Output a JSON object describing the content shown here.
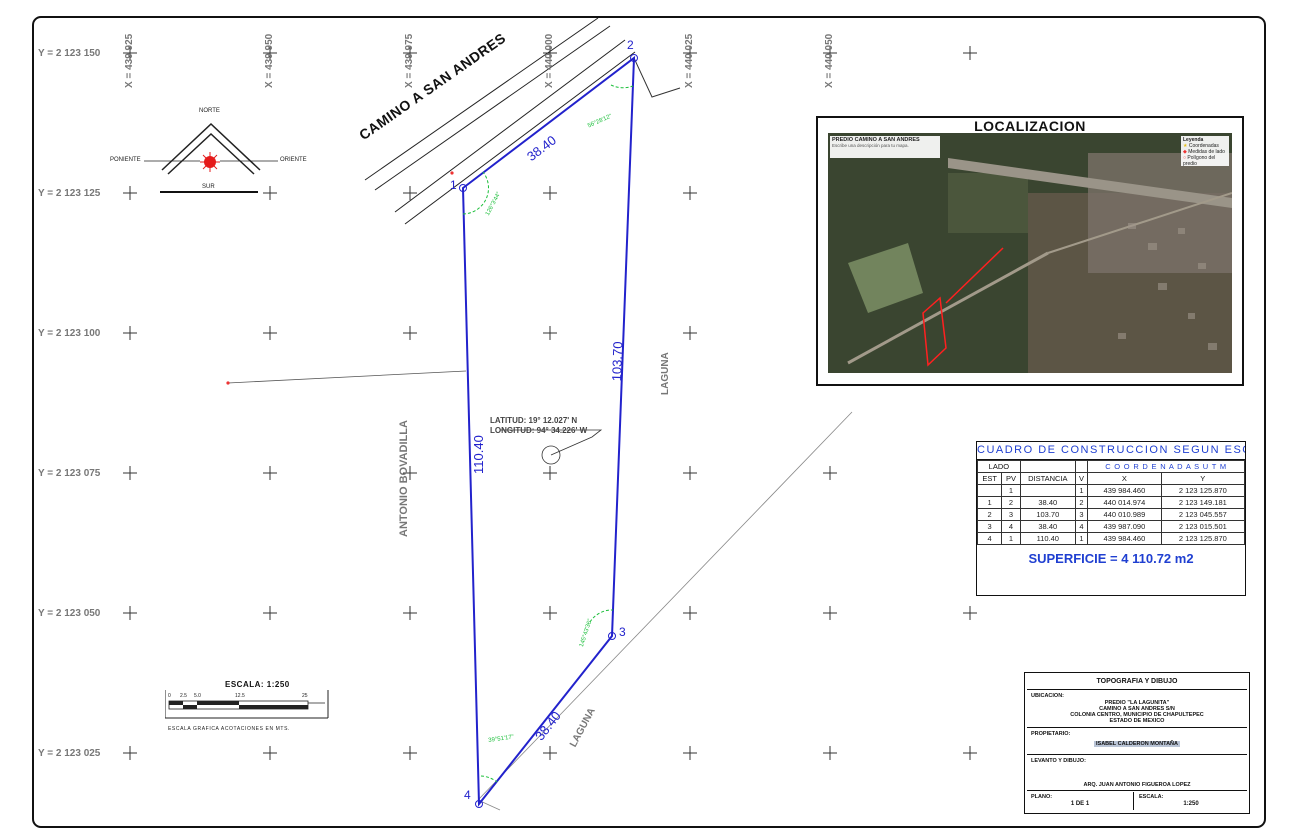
{
  "grid": {
    "y_labels": [
      "Y = 2 123 150",
      "Y = 2 123 125",
      "Y = 2 123 100",
      "Y = 2 123 075",
      "Y = 2 123 050",
      "Y = 2 123 025"
    ],
    "x_labels": [
      "X = 439 925",
      "X = 439 950",
      "X = 439 975",
      "X = 440 000",
      "X = 440 025",
      "X = 440 050"
    ]
  },
  "compass": {
    "north": "NORTE",
    "south": "SUR",
    "east": "ORIENTE",
    "west": "PONIENTE"
  },
  "streets": {
    "top_road": "CAMINO A SAN ANDRES",
    "west": "ANTONIO BOVADILLA",
    "east": "LAGUNA",
    "southeast": "LAGUNA"
  },
  "polygon": {
    "vertex_labels": [
      "1",
      "2",
      "3",
      "4"
    ],
    "side_lengths": [
      "38.40",
      "103.70",
      "38.40",
      "110.40"
    ],
    "angles": [
      "126°3'44\"",
      "56°28'12\"",
      "145°43'36\"",
      "39°51'17\""
    ]
  },
  "coordinates_note": {
    "lat": "LATITUD: 19° 12.027' N",
    "lon": "LONGITUD: 94° 34.226' W"
  },
  "localization": {
    "title": "LOCALIZACION",
    "inset_title": "PREDIO CAMINO A SAN ANDRES",
    "inset_subtitle": "Escribe una descripción para tu mapa.",
    "legend_title": "Leyenda",
    "legend_items": [
      "Coordenadas",
      "Medidas de lado",
      "Polígono del predio"
    ]
  },
  "construction_table": {
    "title": "CUADRO DE CONSTRUCCION SEGUN ESCRITURA",
    "group_headers": {
      "lado": "LADO",
      "coords": "C O O R D E N A D A S  U T M"
    },
    "headers": [
      "EST",
      "PV",
      "DISTANCIA",
      "V",
      "X",
      "Y"
    ],
    "rows": [
      [
        "",
        "1",
        "",
        "1",
        "439 984.460",
        "2 123 125.870"
      ],
      [
        "1",
        "2",
        "38.40",
        "2",
        "440 014.974",
        "2 123 149.181"
      ],
      [
        "2",
        "3",
        "103.70",
        "3",
        "440 010.989",
        "2 123 045.557"
      ],
      [
        "3",
        "4",
        "38.40",
        "4",
        "439 987.090",
        "2 123 015.501"
      ],
      [
        "4",
        "1",
        "110.40",
        "1",
        "439 984.460",
        "2 123 125.870"
      ]
    ],
    "surface": "SUPERFICIE = 4 110.72 m2"
  },
  "title_block": {
    "header": "TOPOGRAFIA Y DIBUJO",
    "ubicacion_label": "UBICACION:",
    "ubicacion_lines": [
      "PREDIO \"LA LAGUNITA\"",
      "CAMINO A SAN ANDRES S/N",
      "COLONIA CENTRO, MUNICIPIO DE CHAPULTEPEC",
      "ESTADO DE MEXICO"
    ],
    "propietario_label": "PROPIETARIO:",
    "propietario": "ISABEL CALDERON MONTAÑA",
    "levanto_label": "LEVANTO Y DIBUJO:",
    "levanto": "ARQ. JUAN ANTONIO FIGUEROA LOPEZ",
    "plano_label": "PLANO:",
    "plano": "1 DE 1",
    "escala_label": "ESCALA:",
    "escala": "1:250"
  },
  "scale_bar": {
    "title": "ESCALA:  1:250",
    "ticks": [
      "0",
      "2.5",
      "5.0",
      "12.5",
      "25"
    ],
    "caption": "ESCALA GRAFICA ACOTACIONES EN MTS."
  },
  "colors": {
    "boundary": "#2222cc",
    "label_blue": "#1f3fd1",
    "angle_green": "#1bbf3a",
    "grid": "#777777"
  }
}
